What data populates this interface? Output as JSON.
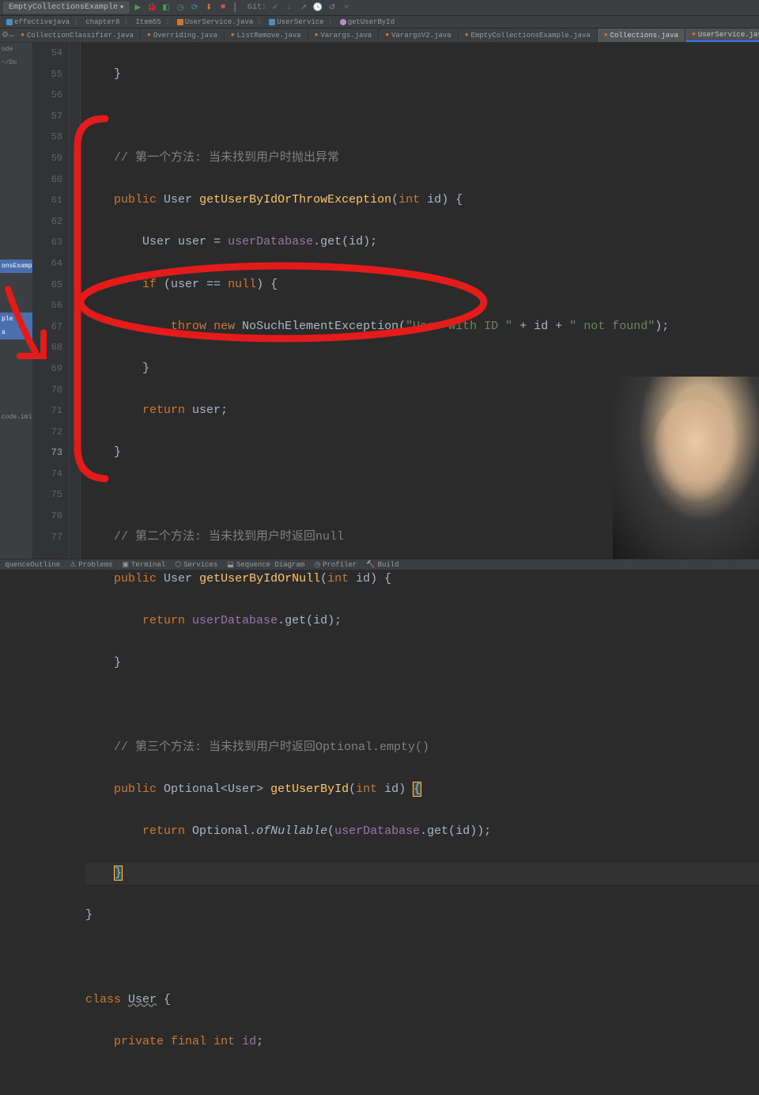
{
  "toolbar": {
    "config": "EmptyCollectionsExample",
    "git_label": "Git:"
  },
  "breadcrumb": {
    "items": [
      "effectivejava",
      "chapter8",
      "Item55",
      "UserService.java",
      "UserService",
      "getUserById"
    ]
  },
  "side": {
    "node": "ode",
    "path": "~/Do",
    "item1": "onsExamp",
    "item2": "ple",
    "item3": "a",
    "item4": "code.iml"
  },
  "tabs": [
    {
      "label": "CollectionClassifier.java"
    },
    {
      "label": "Overriding.java"
    },
    {
      "label": "ListRemove.java"
    },
    {
      "label": "Varargs.java"
    },
    {
      "label": "VarargsV2.java"
    },
    {
      "label": "EmptyCollectionsExample.java"
    },
    {
      "label": "Collections.java"
    },
    {
      "label": "UserService.java"
    }
  ],
  "gutter": {
    "start": 54,
    "end": 77
  },
  "code": {
    "l54": "    }",
    "l55": "",
    "l56_c": "    // 第一个方法: 当未找到用户时抛出异常",
    "l57": {
      "kw1": "public",
      "type": "User",
      "method": "getUserByIdOrThrowException",
      "kw2": "int",
      "param": "id"
    },
    "l58": {
      "type": "User",
      "var": "user",
      "field": "userDatabase",
      "call": "get",
      "arg": "id"
    },
    "l59": {
      "kw": "if",
      "var": "user",
      "kw2": "null"
    },
    "l60": {
      "kw1": "throw",
      "kw2": "new",
      "cls": "NoSuchElementException",
      "str1": "\"User with ID \"",
      "var": "id",
      "str2": "\" not found\""
    },
    "l61": "        }",
    "l62": {
      "kw": "return",
      "var": "user"
    },
    "l63": "    }",
    "l64": "",
    "l65_c": "    // 第二个方法: 当未找到用户时返回null",
    "l66": {
      "kw1": "public",
      "type": "User",
      "method": "getUserByIdOrNull",
      "kw2": "int",
      "param": "id"
    },
    "l67": {
      "kw": "return",
      "field": "userDatabase",
      "call": "get",
      "arg": "id"
    },
    "l68": "    }",
    "l69": "",
    "l70_c": "    // 第三个方法: 当未找到用户时返回Optional.empty()",
    "l71": {
      "kw1": "public",
      "type": "Optional<User>",
      "method": "getUserById",
      "kw2": "int",
      "param": "id"
    },
    "l72": {
      "kw": "return",
      "cls": "Optional",
      "call": "ofNullable",
      "field": "userDatabase",
      "call2": "get",
      "arg": "id"
    },
    "l73": "    }",
    "l74": "}",
    "l75": "",
    "l76": {
      "kw": "class",
      "name": "User"
    },
    "l77": {
      "kw1": "private",
      "kw2": "final",
      "kw3": "int",
      "var": "id"
    }
  },
  "bottom": {
    "items": [
      "quenceOutline",
      "Problems",
      "Terminal",
      "Services",
      "Sequence Diagram",
      "Profiler",
      "Build"
    ]
  }
}
